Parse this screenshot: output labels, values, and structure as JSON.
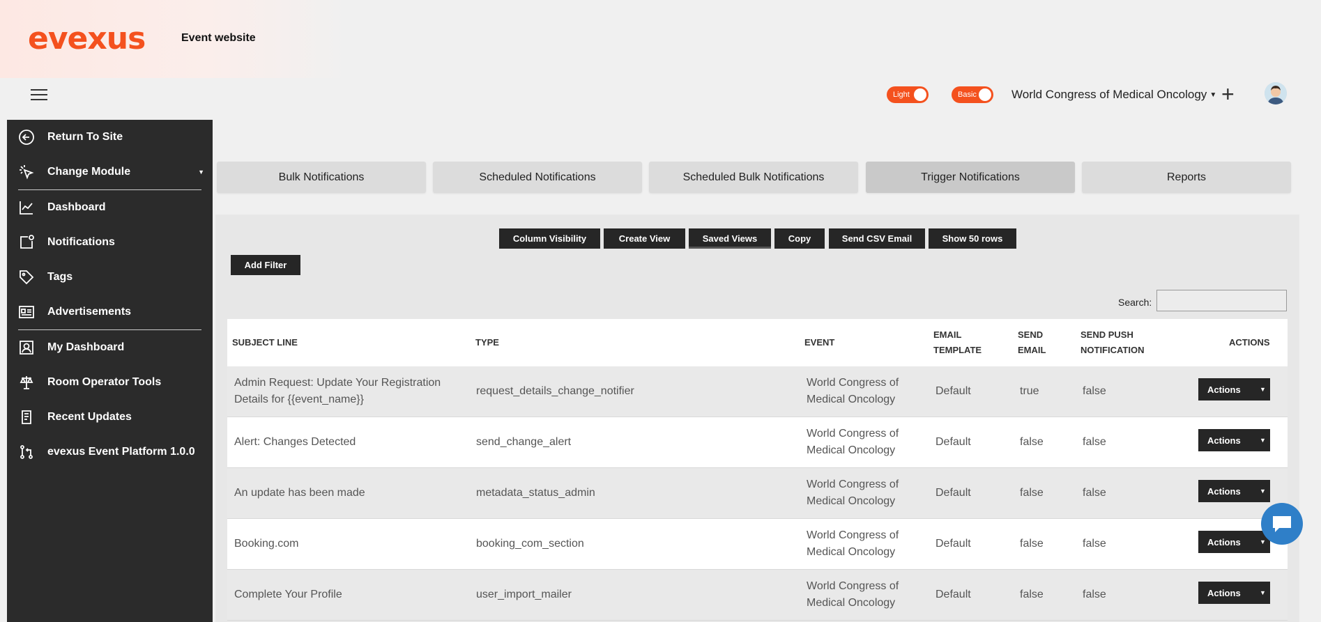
{
  "brand": {
    "logo": "evexus",
    "site_name": "Event website"
  },
  "header": {
    "toggle_light": "Light",
    "toggle_basic": "Basic",
    "event_selector": "World Congress of Medical Oncology",
    "plus": "+"
  },
  "sidebar": {
    "items": [
      {
        "label": "Return To Site",
        "icon": "arrow-left-circle-icon"
      },
      {
        "label": "Change Module",
        "icon": "cursor-click-icon"
      },
      {
        "label": "Dashboard",
        "icon": "line-chart-icon"
      },
      {
        "label": "Notifications",
        "icon": "notification-icon"
      },
      {
        "label": "Tags",
        "icon": "tag-icon"
      },
      {
        "label": "Advertisements",
        "icon": "advertisement-icon"
      },
      {
        "label": "My Dashboard",
        "icon": "user-card-icon"
      },
      {
        "label": "Room Operator Tools",
        "icon": "tools-icon"
      },
      {
        "label": "Recent Updates",
        "icon": "document-icon"
      },
      {
        "label": "evexus Event Platform 1.0.0",
        "icon": "branch-icon"
      }
    ]
  },
  "tabs": [
    {
      "label": "Bulk Notifications"
    },
    {
      "label": "Scheduled Notifications"
    },
    {
      "label": "Scheduled Bulk Notifications"
    },
    {
      "label": "Trigger Notifications",
      "active": true
    },
    {
      "label": "Reports"
    }
  ],
  "toolbar": {
    "column_visibility": "Column Visibility",
    "create_view": "Create View",
    "saved_views": "Saved Views",
    "copy": "Copy",
    "send_csv_email": "Send CSV Email",
    "show_rows": "Show 50 rows",
    "add_filter": "Add Filter",
    "search_label": "Search:",
    "search_value": ""
  },
  "table": {
    "headers": [
      "SUBJECT LINE",
      "TYPE",
      "EVENT",
      "EMAIL TEMPLATE",
      "SEND EMAIL",
      "SEND PUSH NOTIFICATION",
      "ACTIONS"
    ],
    "rows": [
      {
        "subject": "Admin Request: Update Your Registration Details for {{event_name}}",
        "type": "request_details_change_notifier",
        "event": "World Congress of Medical Oncology",
        "template": "Default",
        "send_email": "true",
        "send_push": "false",
        "action": "Actions"
      },
      {
        "subject": "Alert: Changes Detected",
        "type": "send_change_alert",
        "event": "World Congress of Medical Oncology",
        "template": "Default",
        "send_email": "false",
        "send_push": "false",
        "action": "Actions"
      },
      {
        "subject": "An update has been made",
        "type": "metadata_status_admin",
        "event": "World Congress of Medical Oncology",
        "template": "Default",
        "send_email": "false",
        "send_push": "false",
        "action": "Actions"
      },
      {
        "subject": "Booking.com",
        "type": "booking_com_section",
        "event": "World Congress of Medical Oncology",
        "template": "Default",
        "send_email": "false",
        "send_push": "false",
        "action": "Actions"
      },
      {
        "subject": "Complete Your Profile",
        "type": "user_import_mailer",
        "event": "World Congress of Medical Oncology",
        "template": "Default",
        "send_email": "false",
        "send_push": "false",
        "action": "Actions"
      }
    ]
  },
  "colors": {
    "accent": "#f4511e",
    "sidebar_bg": "#2b2b2b",
    "button_dark": "#262626",
    "chat_blue": "#2f7fc8"
  }
}
